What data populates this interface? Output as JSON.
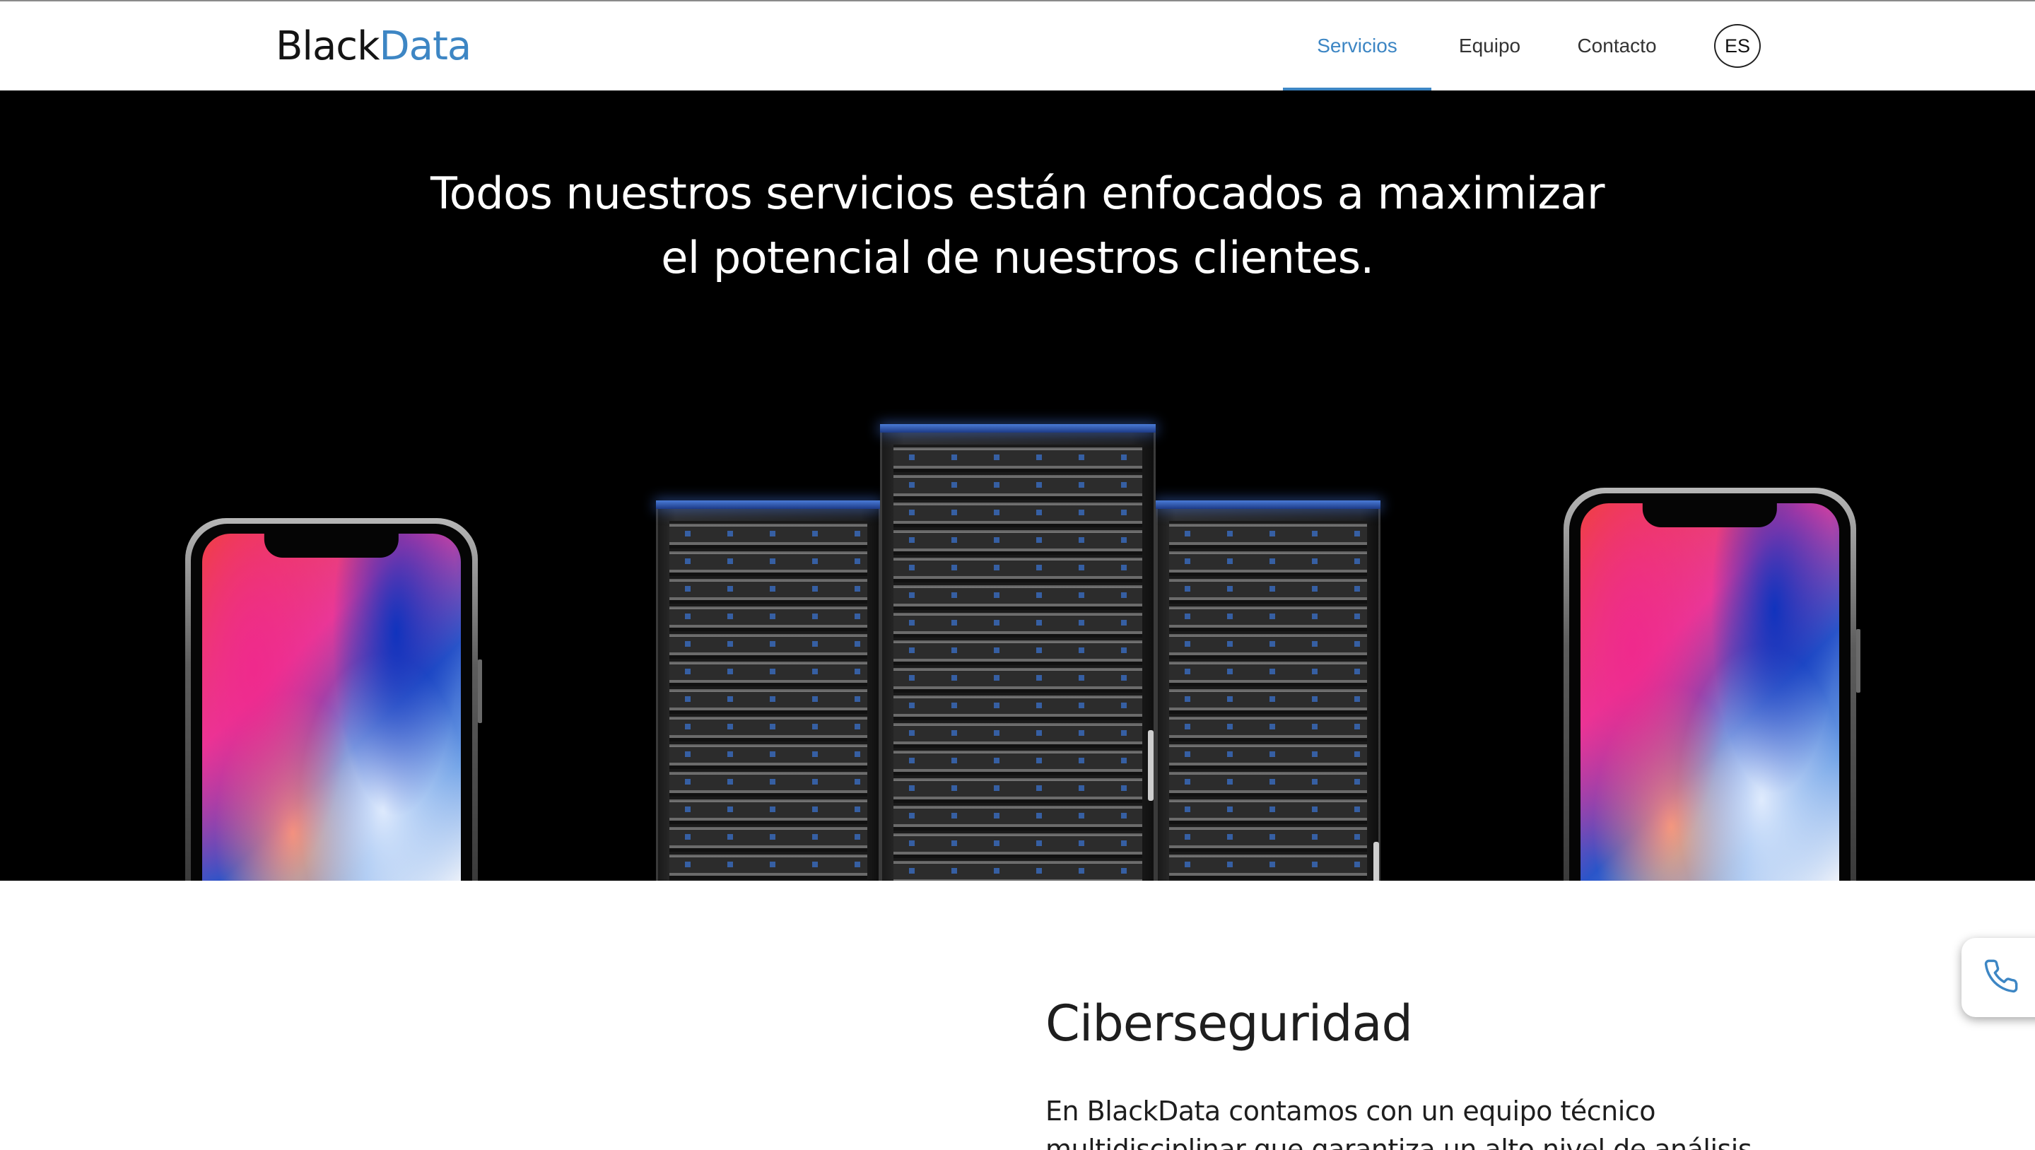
{
  "header": {
    "logo": {
      "part1": "Black",
      "part2": "Data"
    },
    "nav": [
      {
        "label": "Servicios",
        "active": true
      },
      {
        "label": "Equipo",
        "active": false
      },
      {
        "label": "Contacto",
        "active": false
      }
    ],
    "language": "ES"
  },
  "hero": {
    "title_line1": "Todos nuestros servicios están enfocados a maximizar",
    "title_line2": "el potencial de nuestros clientes."
  },
  "section": {
    "title": "Ciberseguridad",
    "body_line1": "En BlackData contamos con un equipo técnico",
    "body_line2": "multidisciplinar que garantiza un alto nivel de análisis y"
  },
  "floating": {
    "icon": "phone-icon"
  },
  "colors": {
    "accent": "#3d86c4",
    "hero_bg": "#000000",
    "text": "#1e1e1e"
  }
}
